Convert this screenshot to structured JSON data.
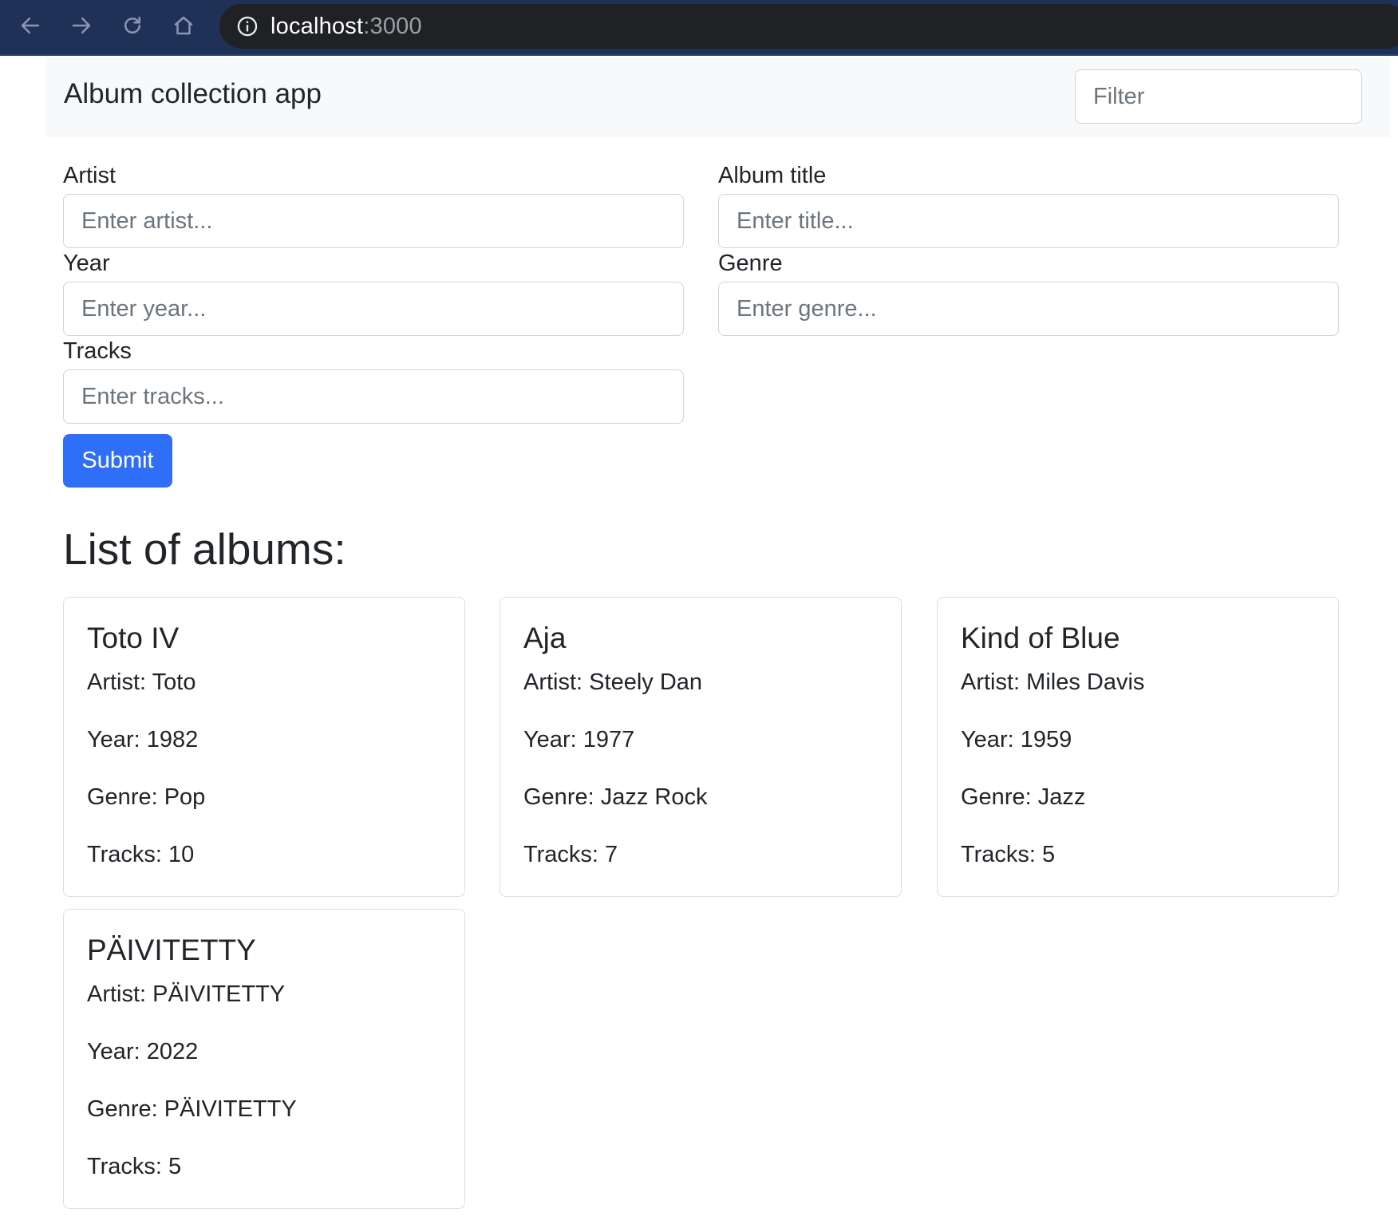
{
  "browser": {
    "url_host": "localhost",
    "url_port": ":3000"
  },
  "navbar": {
    "brand": "Album collection app",
    "filter_placeholder": "Filter"
  },
  "form": {
    "artist_label": "Artist",
    "artist_placeholder": "Enter artist...",
    "title_label": "Album title",
    "title_placeholder": "Enter title...",
    "year_label": "Year",
    "year_placeholder": "Enter year...",
    "genre_label": "Genre",
    "genre_placeholder": "Enter genre...",
    "tracks_label": "Tracks",
    "tracks_placeholder": "Enter tracks...",
    "submit_label": "Submit"
  },
  "list_heading": "List of albums:",
  "albums": [
    {
      "title": "Toto IV",
      "artist": "Artist: Toto",
      "year": "Year: 1982",
      "genre": "Genre: Pop",
      "tracks": "Tracks: 10"
    },
    {
      "title": "Aja",
      "artist": "Artist: Steely Dan",
      "year": "Year: 1977",
      "genre": "Genre: Jazz Rock",
      "tracks": "Tracks: 7"
    },
    {
      "title": "Kind of Blue",
      "artist": "Artist: Miles Davis",
      "year": "Year: 1959",
      "genre": "Genre: Jazz",
      "tracks": "Tracks: 5"
    },
    {
      "title": "PÄIVITETTY",
      "artist": "Artist: PÄIVITETTY",
      "year": "Year: 2022",
      "genre": "Genre: PÄIVITETTY",
      "tracks": "Tracks: 5"
    }
  ],
  "colors": {
    "browser_bar": "#1f3156",
    "navbar_bg": "#f8f9fa",
    "primary_button": "#2f6ef6"
  },
  "icons": [
    "back-arrow-icon",
    "forward-arrow-icon",
    "reload-icon",
    "home-icon",
    "info-icon"
  ]
}
